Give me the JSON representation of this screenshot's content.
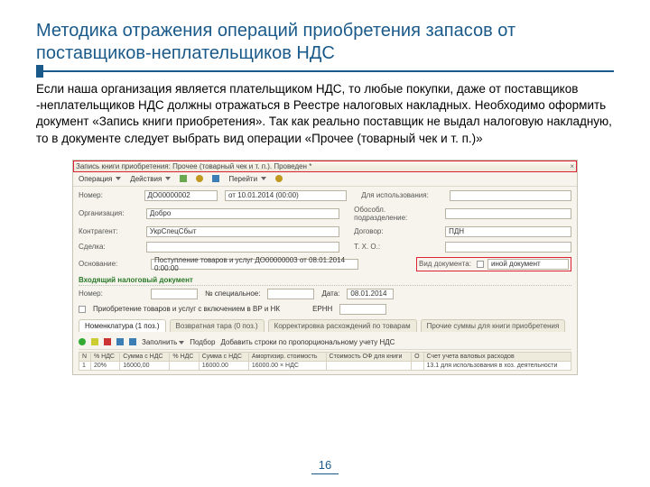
{
  "title": "Методика отражения операций приобретения запасов от поставщиков-неплательщиков НДС",
  "body": "Если наша организация является плательщиком НДС, то любые покупки, даже от поставщиков -неплательщиков НДС должны отражаться в Реестре налоговых накладных. Необходимо оформить документ «Запись книги приобретения». Так как реально поставщик не выдал налоговую накладную, то в документе следует выбрать вид операции «Прочее (товарный чек и т. п.)»",
  "page": "16",
  "app": {
    "window_title": "Запись книги приобретения: Прочее (товарный чек и т. п.). Проведен *",
    "close": "×",
    "menu": {
      "op": "Операция",
      "actions": "Действия",
      "go": "Перейти"
    },
    "fields": {
      "num_l": "Номер:",
      "num": "ДО00000002",
      "date": "от 10.01.2014 (00:00)",
      "org_l": "Организация:",
      "org": "Добро",
      "ka_l": "Контрагент:",
      "ka": "УкрСпецСбыт",
      "dog_l": "Сделка:",
      "osn_l": "Основание:",
      "osn": "Поступление товаров и услуг ДО00000003 от 08.01.2014 0:00:00",
      "right1_l": "Для использования:",
      "right1": "",
      "right2_l": "Обособл. подразделение:",
      "right2": "",
      "right3_l": "Договор:",
      "right3": "ПДН",
      "right4_l": "Т. Х. О.:",
      "right4": "",
      "vid_l": "Вид документа:",
      "vid_opts": "иной документ",
      "section": "Входящий налоговый документ",
      "incnum_l": "Номер:",
      "incnum": "",
      "spec_l": "№ специальное:",
      "spec": "",
      "incdate_l": "Дата:",
      "incdate": "08.01.2014",
      "chk1": "Приобретение товаров и услуг с включением в ВР и НК",
      "erpn": "ЕРНН",
      "tabs": [
        "Номенклатура (1 поз.)",
        "Возвратная тара (0 поз.)",
        "Корректировка расхождений по товарам",
        "Прочие суммы для книги приобретения"
      ],
      "tool_zap": "Заполнить",
      "tool_pod": "Подбор",
      "tool_add": "Добавить строки по пропорциональному учету НДС",
      "th": [
        "N",
        "% НДС",
        "Сумма с НДС",
        "% НДС",
        "Сумма с НДС",
        "Амортизир. стоимость",
        "Стоимость ОФ для книги",
        "О",
        "Счет учета валовых расходов"
      ],
      "td": [
        "1",
        "20%",
        "16000,00",
        "",
        "16000.00",
        "16000.00 × НДС",
        "",
        "",
        "13.1 для использования в хоз. деятельности"
      ]
    }
  }
}
